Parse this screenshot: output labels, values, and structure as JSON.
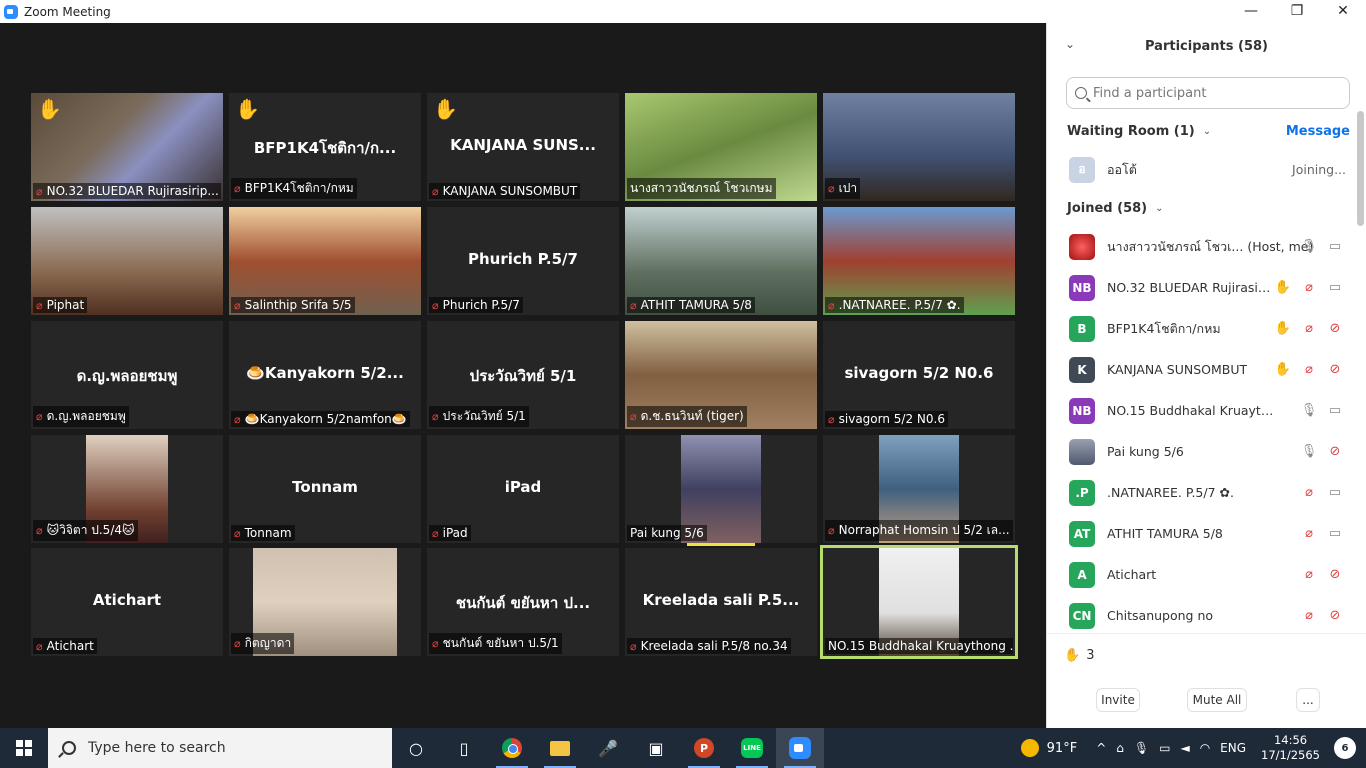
{
  "window": {
    "title": "Zoom Meeting",
    "minimize": "—",
    "maximize": "❐",
    "close": "✕"
  },
  "tiles": [
    {
      "caption": "NO.32 BLUEDAR Rujirasirip...",
      "hand": true,
      "video": "v1"
    },
    {
      "caption": "BFP1K4โชติกา/กหม",
      "big_name": "BFP1K4โชติกา/ก...",
      "hand": true
    },
    {
      "caption": "KANJANA SUNSOMBUT",
      "big_name": "KANJANA SUNS...",
      "hand": true
    },
    {
      "caption": "นางสาววนัชภรณ์ โชวเกษม",
      "video": "v2",
      "mic_on": true
    },
    {
      "caption": "เปา",
      "video": "v3"
    },
    {
      "caption": "Piphat",
      "video": "v4"
    },
    {
      "caption": "Salinthip Srifa 5/5",
      "video": "v5"
    },
    {
      "caption": "Phurich  P.5/7",
      "big_name": "Phurich  P.5/7"
    },
    {
      "caption": "ATHIT TAMURA  5/8",
      "video": "v6"
    },
    {
      "caption": ".NATNAREE. P.5/7 ✿.",
      "video": "v7"
    },
    {
      "caption": "ด.ญ.พลอยชมพู",
      "big_name": "ด.ญ.พลอยชมพู"
    },
    {
      "caption": "🍮Kanyakorn 5/2namfon🍮",
      "big_name": "🍮Kanyakorn 5/2..."
    },
    {
      "caption": "ประวัณวิทย์ 5/1",
      "big_name": "ประวัณวิทย์ 5/1"
    },
    {
      "caption": "ด.ช.ธนวินท์ (tiger)",
      "video": "v8"
    },
    {
      "caption": "sivagorn 5/2 N0.6",
      "big_name": "sivagorn 5/2 N0.6"
    },
    {
      "caption": "🐱วิจิตา ป.5/4🐱",
      "inset": "iv1"
    },
    {
      "caption": "Tonnam",
      "big_name": "Tonnam"
    },
    {
      "caption": "iPad",
      "big_name": "iPad"
    },
    {
      "caption": "Pai kung 5/6",
      "inset": "iv2",
      "mic_on": true
    },
    {
      "caption": "Norraphat Homsin ป 5/2 เล...",
      "inset": "iv3"
    },
    {
      "caption": "Atichart",
      "big_name": "Atichart"
    },
    {
      "caption": "กิตญาดา",
      "inset": "iv4"
    },
    {
      "caption": "ชนกันต์ ขยันหา ป.5/1",
      "big_name": "ชนกันต์ ขยันหา ป..."
    },
    {
      "caption": "Kreelada sali P.5/8 no.34",
      "big_name": "Kreelada sali P.5..."
    },
    {
      "caption": "NO.15 Buddhakal Kruaythong ...",
      "inset": "iv5",
      "active": true,
      "mic_on": true
    }
  ],
  "panel": {
    "title": "Participants (58)",
    "search_placeholder": "Find a participant",
    "waiting_room": {
      "label": "Waiting Room (1)",
      "message_label": "Message",
      "entries": [
        {
          "initials": "อ",
          "name": "ออโต้",
          "status": "Joining..."
        }
      ]
    },
    "joined_label": "Joined (58)",
    "participants": [
      {
        "initials": "",
        "color": "img-red",
        "name": "นางสาววนัชภรณ์ โชวเ...",
        "tag": "(Host, me)",
        "hand": "",
        "mic": "on",
        "cam": "on"
      },
      {
        "initials": "NB",
        "color": "#8a3ab9",
        "name": "NO.32 BLUEDAR Rujirasirip...",
        "tag": "",
        "hand": "pale",
        "mic": "off",
        "cam": "on"
      },
      {
        "initials": "B",
        "color": "#26a65b",
        "name": "BFP1K4โชติกา/กหม",
        "tag": "",
        "hand": "pale",
        "mic": "off",
        "cam": "off"
      },
      {
        "initials": "K",
        "color": "#404a56",
        "name": "KANJANA SUNSOMBUT",
        "tag": "",
        "hand": "yellow",
        "mic": "off",
        "cam": "off"
      },
      {
        "initials": "NB",
        "color": "#8a3ab9",
        "name": "NO.15 Buddhakal Kruaythong ...",
        "tag": "",
        "hand": "",
        "mic": "on",
        "cam": "on"
      },
      {
        "initials": "",
        "color": "img-sky",
        "name": "Pai kung 5/6",
        "tag": "",
        "hand": "",
        "mic": "on",
        "cam": "off"
      },
      {
        "initials": ".P",
        "color": "#26a65b",
        "name": ".NATNAREE. P.5/7 ✿.",
        "tag": "",
        "hand": "",
        "mic": "off",
        "cam": "on"
      },
      {
        "initials": "AT",
        "color": "#26a65b",
        "name": "ATHIT TAMURA  5/8",
        "tag": "",
        "hand": "",
        "mic": "off",
        "cam": "on"
      },
      {
        "initials": "A",
        "color": "#26a65b",
        "name": "Atichart",
        "tag": "",
        "hand": "",
        "mic": "off",
        "cam": "off"
      },
      {
        "initials": "CN",
        "color": "#26a65b",
        "name": "Chitsanupong no",
        "tag": "",
        "hand": "",
        "mic": "off",
        "cam": "off"
      }
    ],
    "raised_hands_count": "3",
    "invite_label": "Invite",
    "mute_all_label": "Mute All",
    "more_label": "..."
  },
  "taskbar": {
    "search_placeholder": "Type here to search",
    "temperature": "91°F",
    "language": "ENG",
    "time": "14:56",
    "date": "17/1/2565",
    "notification_count": "6"
  },
  "icons": {
    "mic_off": "🎙",
    "hand": "✋"
  }
}
